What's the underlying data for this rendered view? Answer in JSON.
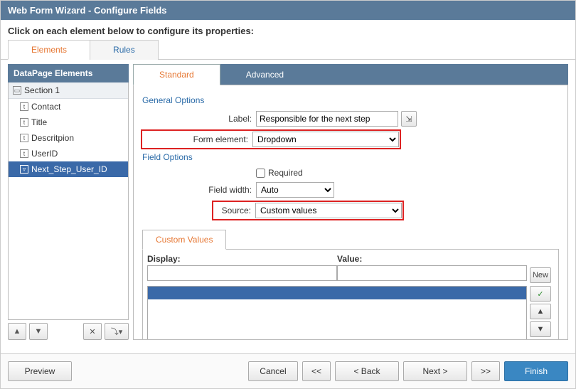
{
  "title": "Web Form Wizard - Configure Fields",
  "instruction": "Click on each element below to configure its properties:",
  "top_tabs": {
    "elements": "Elements",
    "rules": "Rules"
  },
  "sidebar": {
    "header": "DataPage Elements",
    "section": "Section 1",
    "items": [
      "Contact",
      "Title",
      "Descritpion",
      "UserID",
      "Next_Step_User_ID"
    ]
  },
  "sub_tabs": {
    "standard": "Standard",
    "advanced": "Advanced"
  },
  "general": {
    "title": "General Options",
    "label_label": "Label:",
    "label_value": "Responsible for the next step",
    "form_element_label": "Form element:",
    "form_element_value": "Dropdown"
  },
  "field_options": {
    "title": "Field Options",
    "required_label": "Required",
    "field_width_label": "Field width:",
    "field_width_value": "Auto",
    "source_label": "Source:",
    "source_value": "Custom values"
  },
  "custom_values": {
    "tab": "Custom Values",
    "display_label": "Display:",
    "value_label": "Value:",
    "new_btn": "New"
  },
  "footer": {
    "preview": "Preview",
    "cancel": "Cancel",
    "prev_all": "<<",
    "back": "< Back",
    "next": "Next >",
    "next_all": ">>",
    "finish": "Finish"
  }
}
